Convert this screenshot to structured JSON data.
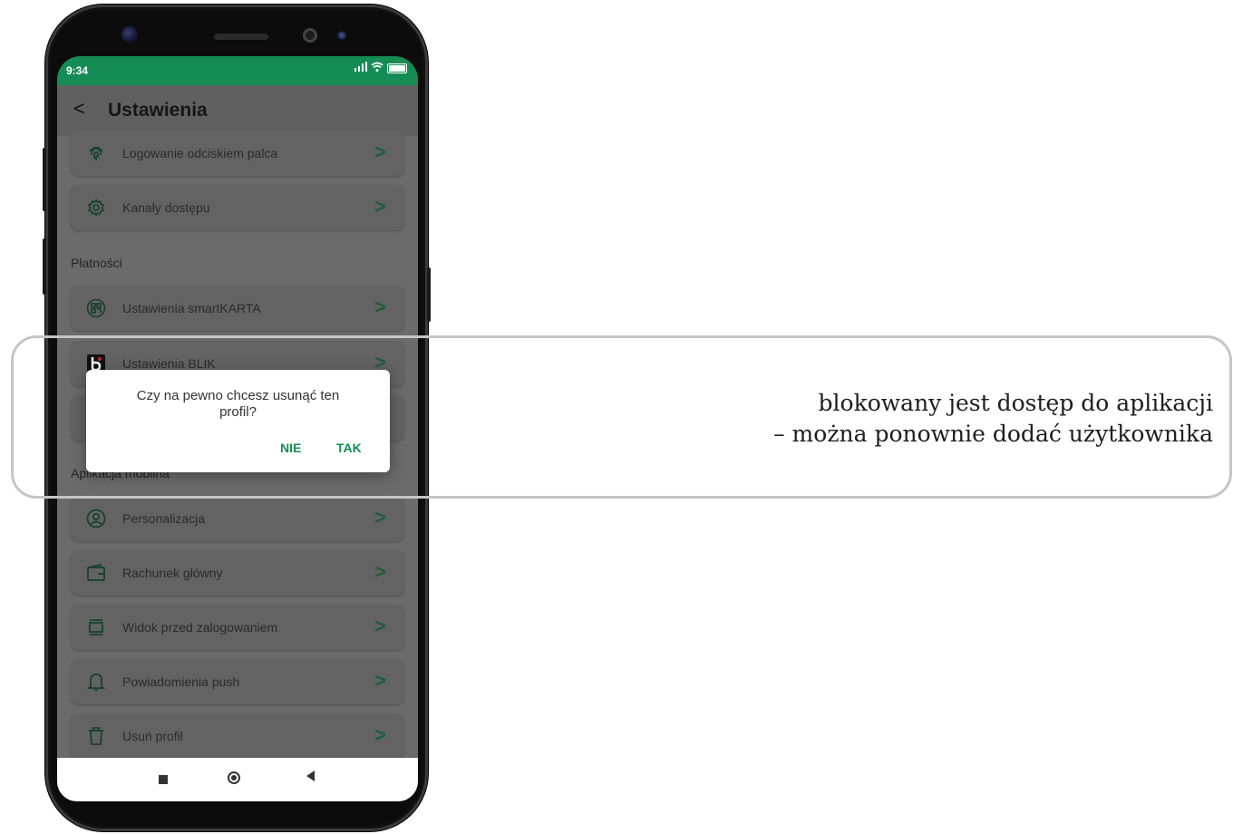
{
  "status_bar": {
    "time": "9:34",
    "battery": "100"
  },
  "header": {
    "title": "Ustawienia"
  },
  "settings": {
    "items": [
      {
        "label": "Logowanie odciskiem palca",
        "icon": "fingerprint-icon"
      },
      {
        "label": "Kanały dostępu",
        "icon": "gear-icon"
      },
      {
        "label": "Ustawienia smartKARTA",
        "icon": "qr-code-icon"
      },
      {
        "label": "Ustawienia BLIK",
        "icon": "blik-logo-icon"
      },
      {
        "label": "Personalizacja",
        "icon": "user-circle-icon"
      },
      {
        "label": "Rachunek główny",
        "icon": "wallet-icon"
      },
      {
        "label": "Widok przed zalogowaniem",
        "icon": "preview-window-icon"
      },
      {
        "label": "Powiadomienia push",
        "icon": "bell-icon"
      },
      {
        "label": "Usuń profil",
        "icon": "trash-icon"
      }
    ],
    "sections": {
      "payments": "Płatności",
      "mobile_app": "Aplikacja mobilna"
    }
  },
  "dialog": {
    "message": "Czy na pewno chcesz usunąć ten profil?",
    "no_label": "NIE",
    "yes_label": "TAK"
  },
  "caption": {
    "line1": "blokowany jest dostęp do aplikacji",
    "line2": "– można ponownie dodać użytkownika"
  },
  "colors": {
    "accent": "#168c55",
    "overlay": "#6b6b6b"
  }
}
